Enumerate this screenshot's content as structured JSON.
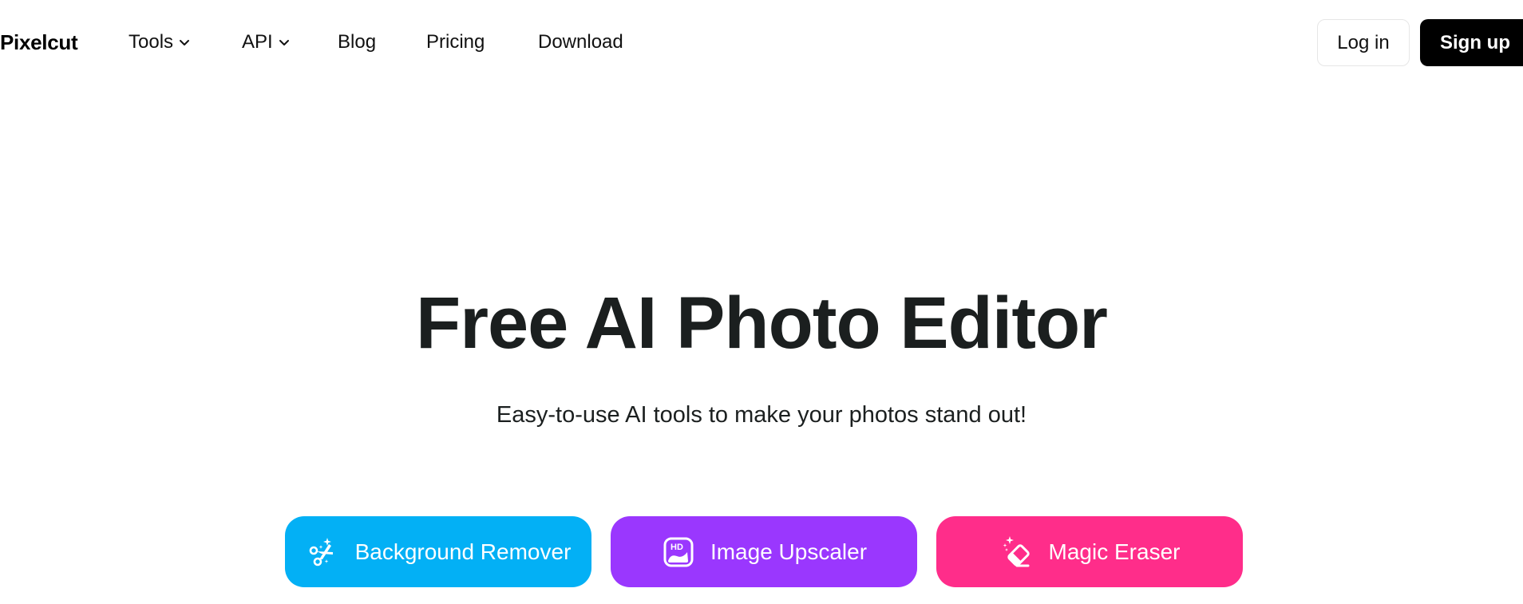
{
  "nav": {
    "logo": "Pixelcut",
    "items": [
      {
        "label": "Tools",
        "has_dropdown": true,
        "icon": "chevron-down-icon"
      },
      {
        "label": "API",
        "has_dropdown": true,
        "icon": "chevron-down-icon"
      },
      {
        "label": "Blog",
        "has_dropdown": false
      },
      {
        "label": "Pricing",
        "has_dropdown": false
      },
      {
        "label": "Download",
        "has_dropdown": false
      }
    ],
    "login_label": "Log in",
    "signup_label": "Sign up"
  },
  "hero": {
    "title": "Free AI Photo Editor",
    "subtitle": "Easy-to-use AI tools to make your photos stand out!"
  },
  "tools": [
    {
      "label": "Background Remover",
      "icon": "scissors-sparkle-icon",
      "color": "#03b0f5"
    },
    {
      "label": "Image Upscaler",
      "icon": "hd-image-icon",
      "color": "#9a37fe"
    },
    {
      "label": "Magic Eraser",
      "icon": "eraser-sparkle-icon",
      "color": "#ff2d8a"
    }
  ]
}
